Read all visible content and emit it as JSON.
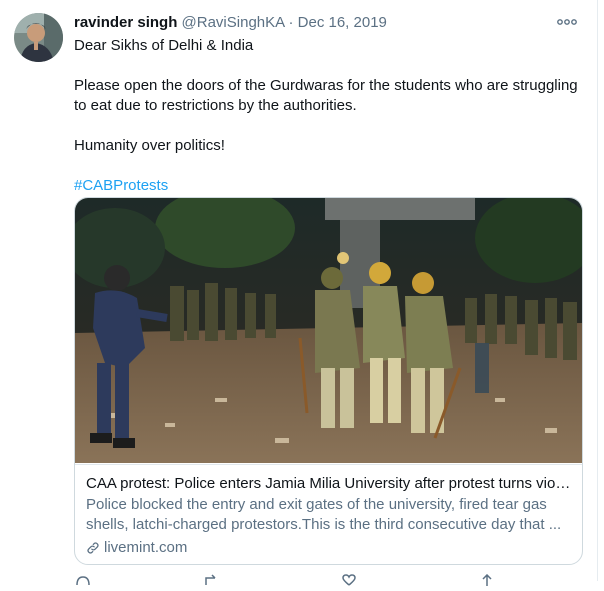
{
  "tweet": {
    "display_name": "ravinder singh",
    "handle": "@RaviSinghKA",
    "separator": "·",
    "date": "Dec 16, 2019",
    "lines": [
      "Dear Sikhs of Delhi & India",
      "Please open the doors of the Gurdwaras for the students who are struggling to eat due to restrictions by the authorities.",
      "Humanity over politics!"
    ],
    "hashtag": "#CABProtests"
  },
  "card": {
    "title": "CAA protest: Police enters Jamia Milia University after protest turns viol...",
    "description": "Police blocked the entry and exit gates of the university, fired tear gas shells, latchi-charged protestors.This is the third consecutive day that ...",
    "domain": "livemint.com"
  },
  "icons": {
    "more": "more-horizontal-icon",
    "link": "link-icon",
    "reply": "reply-icon",
    "retweet": "retweet-icon",
    "like": "heart-icon",
    "share": "share-icon"
  },
  "colors": {
    "accent": "#1da1f2",
    "secondary_text": "#5b7083",
    "primary_text": "#0f1419",
    "border": "#cfd9de"
  }
}
